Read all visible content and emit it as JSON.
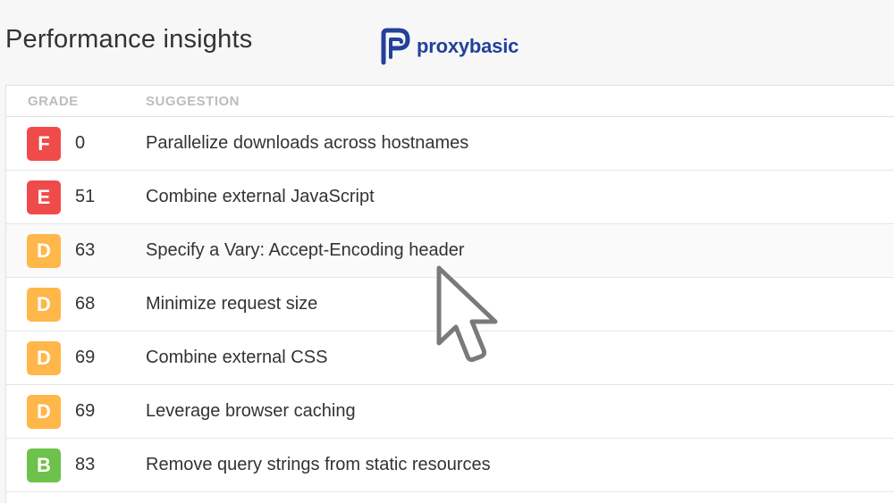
{
  "page": {
    "title": "Performance insights"
  },
  "brand": {
    "name": "proxybasic",
    "color": "#23409a"
  },
  "table": {
    "headers": {
      "grade": "GRADE",
      "suggestion": "SUGGESTION"
    },
    "rows": [
      {
        "grade": "F",
        "score": "0",
        "suggestion": "Parallelize downloads across hostnames",
        "color": "#f04b4b"
      },
      {
        "grade": "E",
        "score": "51",
        "suggestion": "Combine external JavaScript",
        "color": "#f04b4b"
      },
      {
        "grade": "D",
        "score": "63",
        "suggestion": "Specify a Vary: Accept-Encoding header",
        "color": "#ffb74a"
      },
      {
        "grade": "D",
        "score": "68",
        "suggestion": "Minimize request size",
        "color": "#ffb74a"
      },
      {
        "grade": "D",
        "score": "69",
        "suggestion": "Combine external CSS",
        "color": "#ffb74a"
      },
      {
        "grade": "D",
        "score": "69",
        "suggestion": "Leverage browser caching",
        "color": "#ffb74a"
      },
      {
        "grade": "B",
        "score": "83",
        "suggestion": "Remove query strings from static resources",
        "color": "#6cc24a"
      }
    ]
  },
  "cursor": {
    "icon": "mouse-pointer-icon"
  }
}
